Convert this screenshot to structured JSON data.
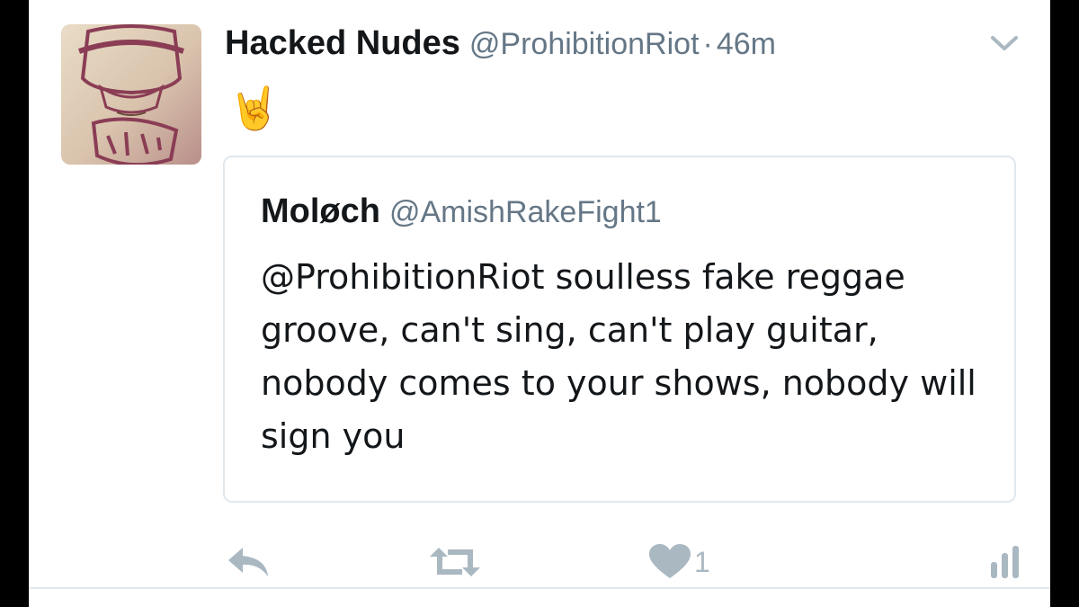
{
  "tweet": {
    "display_name": "Hacked Nudes",
    "handle": "@ProhibitionRiot",
    "separator": "·",
    "time": "46m",
    "body_emoji": "🤘",
    "avatar_icon": "hacked-nudes-shirt-photo"
  },
  "quoted_tweet": {
    "display_name": "Moløch",
    "handle": "@AmishRakeFight1",
    "text": "@ProhibitionRiot soulless fake reggae groove, can't sing, can't play guitar, nobody comes to your shows, nobody will sign you"
  },
  "actions": {
    "reply_icon": "reply-icon",
    "retweet_icon": "retweet-icon",
    "like_icon": "heart-icon",
    "like_count": "1",
    "analytics_icon": "analytics-icon",
    "menu_icon": "chevron-down-icon"
  },
  "colors": {
    "text_primary": "#14171a",
    "text_secondary": "#657786",
    "icon_gray": "#aab8c2",
    "border": "#e1e8ed",
    "frame": "#000000"
  }
}
